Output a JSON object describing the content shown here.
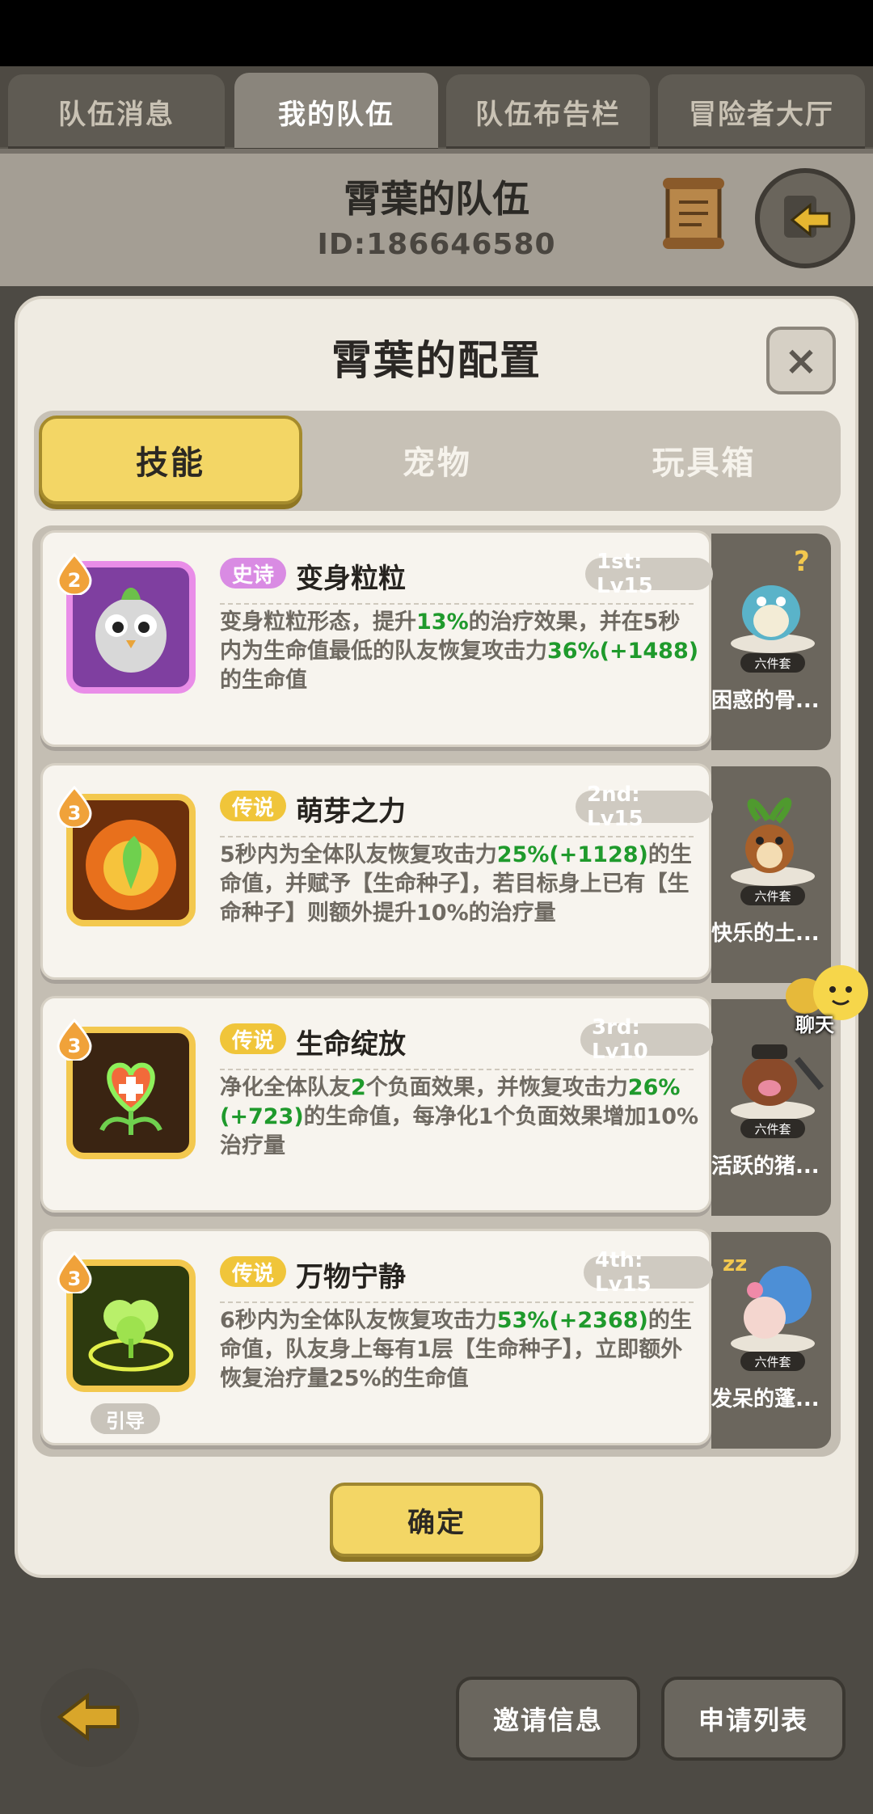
{
  "top_tabs": [
    {
      "label": "队伍消息",
      "active": false
    },
    {
      "label": "我的队伍",
      "active": true
    },
    {
      "label": "队伍布告栏",
      "active": false
    },
    {
      "label": "冒险者大厅",
      "active": false
    }
  ],
  "team": {
    "name": "霄葉的队伍",
    "id": "ID:186646580"
  },
  "modal": {
    "title": "霄葉的配置",
    "close_symbol": "×",
    "tabs": [
      {
        "label": "技能",
        "active": true
      },
      {
        "label": "宠物",
        "active": false
      },
      {
        "label": "玩具箱",
        "active": false
      }
    ],
    "skills": [
      {
        "rarity": "史诗",
        "name": "变身粒粒",
        "slot": "1st: Lv15",
        "star": "2",
        "desc_parts": [
          "变身粒粒形态，提升",
          "13%",
          "的治疗效果，并在5秒内为生命值最低的队友恢复攻击力",
          "36%(+1488)",
          "的生命值"
        ],
        "icon": "owl-icon"
      },
      {
        "rarity": "传说",
        "name": "萌芽之力",
        "slot": "2nd: Lv15",
        "star": "3",
        "desc_parts": [
          "5秒内为全体队友恢复攻击力",
          "25%(+1128)",
          "的生命值，并赋予【生命种子】，若目标身上已有【生命种子】则额外提升10%的治疗量"
        ],
        "icon": "sprout-icon"
      },
      {
        "rarity": "传说",
        "name": "生命绽放",
        "slot": "3rd: Lv10",
        "star": "3",
        "desc_parts": [
          "净化全体队友",
          "2",
          "个负面效果，并恢复攻击力",
          "26%(+723)",
          "的生命值，每净化1个负面效果增加10%治疗量"
        ],
        "icon": "heart-flower-icon"
      },
      {
        "rarity": "传说",
        "name": "万物宁静",
        "slot": "4th: Lv15",
        "star": "3",
        "desc_parts": [
          "6秒内为全体队友恢复攻击力",
          "53%(+2368)",
          "的生命值，队友身上每有1层【生命种子】，立即额外恢复治疗量25%的生命值"
        ],
        "icon": "clover-icon",
        "chip": "引导"
      }
    ],
    "pets": [
      {
        "name": "困惑的骨...",
        "badge": "六件套",
        "icon": "dragon-pet-icon"
      },
      {
        "name": "快乐的土...",
        "badge": "六件套",
        "icon": "squirrel-pet-icon"
      },
      {
        "name": "活跃的猪...",
        "badge": "六件套",
        "icon": "boar-pet-icon"
      },
      {
        "name": "发呆的蓬...",
        "badge": "六件套",
        "icon": "blue-pet-icon"
      }
    ],
    "confirm_label": "确定"
  },
  "chat": {
    "label": "聊天"
  },
  "bottom": {
    "invite_label": "邀请信息",
    "apply_label": "申请列表"
  },
  "colors": {
    "accent_yellow": "#f3d665",
    "epic_pink": "#d98be3",
    "legend_gold": "#f0c53a",
    "highlight_green": "#1f9a2c"
  }
}
